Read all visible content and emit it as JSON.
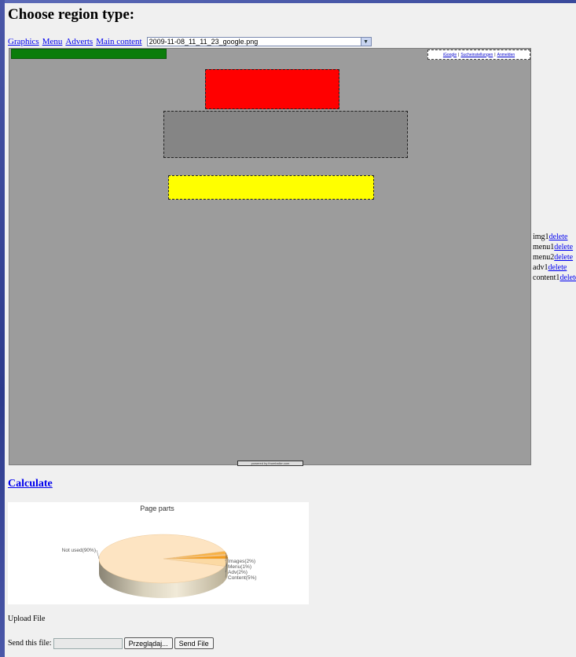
{
  "header": {
    "title": "Choose region type:"
  },
  "toolbar": {
    "types": [
      "Graphics",
      "Menu",
      "Adverts",
      "Main content"
    ],
    "file_select": {
      "value": "2009-11-08_11_11_23_google.png"
    }
  },
  "canvas": {
    "top_bar_links": [
      "iGoogle",
      "Sucheinstellungen",
      "Anmelden"
    ],
    "top_bar_sep": "|",
    "powered_text": "powered by thumbalizr.com"
  },
  "regions": [
    {
      "name": "img1",
      "action": "delete"
    },
    {
      "name": "menu1",
      "action": "delete"
    },
    {
      "name": "menu2",
      "action": "delete"
    },
    {
      "name": "adv1",
      "action": "delete"
    },
    {
      "name": "content1",
      "action": "delete"
    }
  ],
  "calculate_label": "Calculate",
  "chart_data": {
    "type": "pie",
    "title": "Page parts",
    "labels": [
      "Not used(90%)",
      "Images(2%)",
      "Menu(1%)",
      "Adv(2%)",
      "Content(5%)"
    ],
    "categories": [
      "Not used",
      "Images",
      "Menu",
      "Adv",
      "Content"
    ],
    "values": [
      90,
      2,
      1,
      2,
      5
    ],
    "colors": [
      "#fde4c2",
      "#f7b246",
      "#f9c277",
      "#f59c1a",
      "#fbd9a3"
    ]
  },
  "upload": {
    "title": "Upload File",
    "send_label": "Send this file:",
    "browse_label": "Przeglądaj...",
    "send_button": "Send File"
  }
}
